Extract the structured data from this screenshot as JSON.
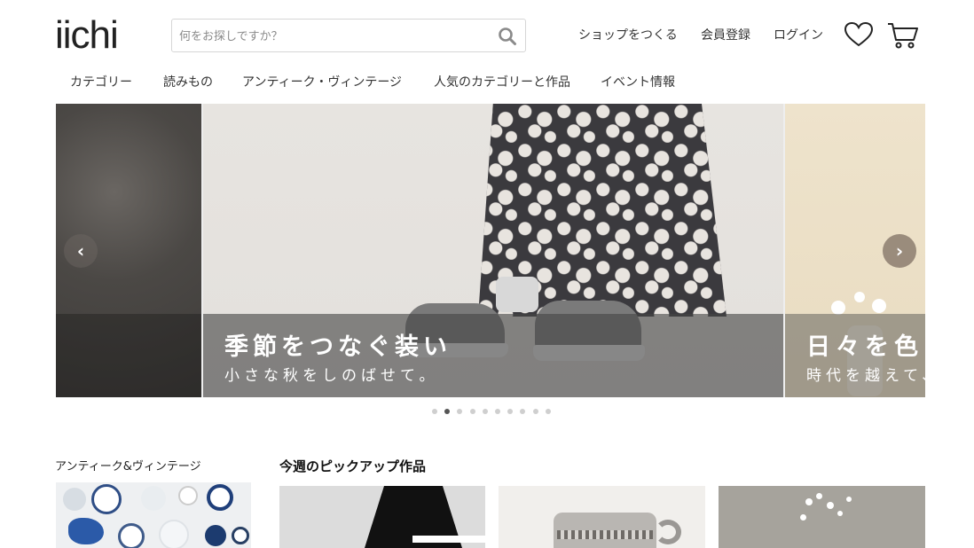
{
  "header": {
    "logo": "iichi",
    "search": {
      "placeholder": "何をお探しですか？"
    },
    "links": [
      "ショップをつくる",
      "会員登録",
      "ログイン"
    ],
    "icons": [
      "search-icon",
      "heart-icon",
      "cart-icon"
    ]
  },
  "nav": {
    "items": [
      "カテゴリー",
      "読みもの",
      "アンティーク・ヴィンテージ",
      "人気のカテゴリーと作品",
      "イベント情報"
    ]
  },
  "carousel": {
    "main": {
      "title": "季節をつなぐ装い",
      "subtitle": "小さな秋をしのばせて。"
    },
    "next": {
      "title": "日々を色",
      "subtitle": "時代を越えて、"
    },
    "prev_label": "‹",
    "next_label": "›",
    "dot_count": 10,
    "active_dot": 1
  },
  "sections": {
    "antique_title": "アンティーク&ヴィンテージ",
    "pickup_title": "今週のピックアップ作品"
  },
  "colors": {
    "text": "#222222",
    "caption_overlay": "#464646",
    "arrow": "#8c7d6e",
    "dot_active": "#555555",
    "dot_inactive": "#cfcfcf"
  }
}
